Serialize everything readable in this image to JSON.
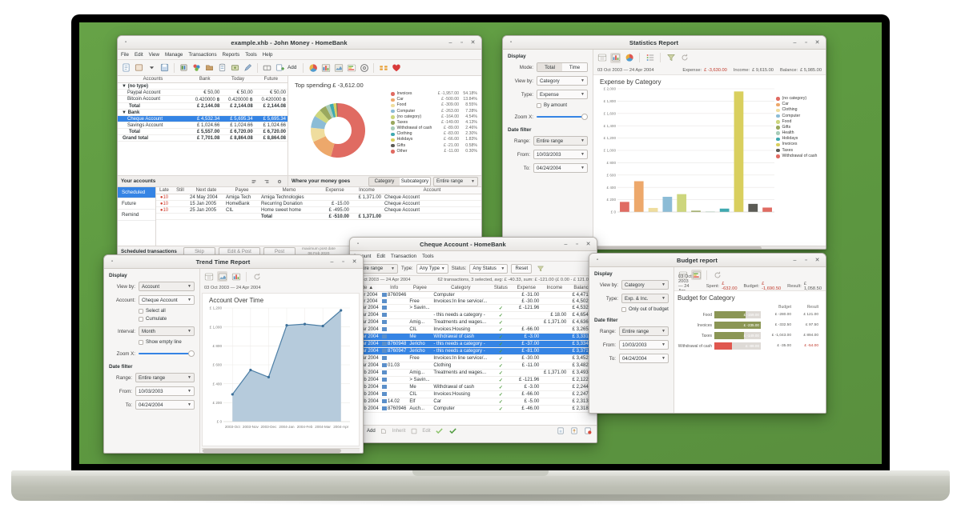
{
  "main_window": {
    "title": "example.xhb - John Money - HomeBank",
    "menus": [
      "File",
      "Edit",
      "View",
      "Manage",
      "Transactions",
      "Reports",
      "Tools",
      "Help"
    ],
    "toolbar": [
      "new-icon",
      "open-icon",
      "chevron-down-icon",
      "save-icon",
      "accounts-icon",
      "payees-icon",
      "categories-icon",
      "archive-icon",
      "budget-icon",
      "assign-icon",
      "ledger-icon",
      "add-icon"
    ],
    "add_label": "Add",
    "report_icons": [
      "pie-chart-icon",
      "statistics-icon",
      "trend-icon",
      "budget-report-icon",
      "vehicle-cost-icon",
      "balance-icon",
      "heart-icon"
    ],
    "accounts_panel": {
      "title": "Your accounts",
      "columns": [
        "Accounts",
        "Bank",
        "Today",
        "Future"
      ],
      "rows": [
        {
          "type": "group",
          "name": "(no type)",
          "bank": "",
          "today": "",
          "future": ""
        },
        {
          "type": "item",
          "name": "Paypal Account",
          "bank": "€ 50,00",
          "today": "€ 50,00",
          "future": "€ 50,00"
        },
        {
          "type": "item",
          "name": "Bitcoin Account",
          "bank": "0.420000 ฿",
          "today": "0.420000 ฿",
          "future": "0.420000 ฿"
        },
        {
          "type": "total",
          "name": "Total",
          "bank": "£ 2,144.08",
          "today": "£ 2,144.08",
          "future": "£ 2,144.08"
        },
        {
          "type": "group",
          "name": "Bank",
          "bank": "",
          "today": "",
          "future": ""
        },
        {
          "type": "selected",
          "name": "Cheque Account",
          "bank": "£ 4,532.34",
          "today": "£ 5,695.34",
          "future": "£ 5,695.34"
        },
        {
          "type": "item",
          "name": "Savings Account",
          "bank": "£ 1,024.66",
          "today": "£ 1,024.66",
          "future": "£ 1,024.66"
        },
        {
          "type": "total",
          "name": "Total",
          "bank": "£ 5,557.00",
          "today": "£ 6,720.00",
          "future": "£ 6,720.00"
        },
        {
          "type": "grand",
          "name": "Grand total",
          "bank": "£ 7,701.08",
          "today": "£ 8,864.08",
          "future": "£ 8,864.08"
        }
      ]
    },
    "spending_panel": {
      "title": "Where your money goes",
      "chart_heading": "Top spending £ -3,612.00",
      "buttons": [
        "Category",
        "Subcategory"
      ],
      "active_button": "Category",
      "range_value": "Entire range"
    },
    "scheduled": {
      "tabs": [
        "Scheduled",
        "Future",
        "Remind"
      ],
      "active_tab": "Scheduled",
      "columns": [
        "Late",
        "Still",
        "Next date",
        "Payee",
        "Memo",
        "Expense",
        "Income",
        "Account"
      ],
      "rows": [
        {
          "late": "10",
          "still": "",
          "next_date": "24 May 2004",
          "payee": "Amiga Tech",
          "memo": "Amiga Technologies",
          "expense": "",
          "income": "£ 1,371.00",
          "account": "Cheque Account"
        },
        {
          "late": "10",
          "still": "",
          "next_date": "15 Jan 2005",
          "payee": "HomeBank",
          "memo": "Recurring Donation",
          "expense": "£ -15.00",
          "income": "",
          "account": "Cheque Account"
        },
        {
          "late": "10",
          "still": "",
          "next_date": "25 Jan 2005",
          "payee": "CIL",
          "memo": "Home sweet home",
          "expense": "£ -495.00",
          "income": "",
          "account": "Cheque Account"
        }
      ],
      "total_label": "Total",
      "total_expense": "£ -510.00",
      "total_income": "£ 1,371.00",
      "footer_label": "Scheduled transactions",
      "footer_buttons": [
        "Skip",
        "Edit & Post",
        "Post"
      ],
      "maxpost_label": "maximum post date",
      "maxpost_value": "06 Feb 2020"
    }
  },
  "statistics_window": {
    "title": "Statistics Report",
    "display_label": "Display",
    "mode_label": "Mode:",
    "mode_options": [
      "Total",
      "Time"
    ],
    "mode_active": "Total",
    "viewby_label": "View by:",
    "viewby_value": "Category",
    "type_label": "Type:",
    "type_value": "Expense",
    "byamount_label": "By amount",
    "zoom_label": "Zoom X:",
    "datefilter_label": "Date filter",
    "range_label": "Range:",
    "range_value": "Entire range",
    "from_label": "From:",
    "from_value": "10/03/2003",
    "to_label": "To:",
    "to_value": "04/24/2004",
    "toolbar_icons": [
      "list-view-icon",
      "column-chart-icon",
      "pie-chart-icon",
      "detail-icon",
      "filter-icon",
      "refresh-icon"
    ],
    "daterange_text": "03 Oct 2003 — 24 Apr 2004",
    "summary": {
      "expense_label": "Expense:",
      "expense_value": "£ -3,630.00",
      "income_label": "Income:",
      "income_value": "£ 9,615.00",
      "balance_label": "Balance:",
      "balance_value": "£ 5,985.00"
    }
  },
  "trend_window": {
    "title": "Trend Time Report",
    "display_label": "Display",
    "viewby_label": "View by:",
    "viewby_value": "Account",
    "account_label": "Account:",
    "account_value": "Cheque Account",
    "selectall_label": "Select all",
    "cumulate_label": "Cumulate",
    "interval_label": "Interval:",
    "interval_value": "Month",
    "showempty_label": "Show empty line",
    "zoom_label": "Zoom X:",
    "datefilter_label": "Date filter",
    "range_label": "Range:",
    "range_value": "Entire range",
    "from_label": "From:",
    "from_value": "10/03/2003",
    "to_label": "To:",
    "to_value": "04/24/2004",
    "toolbar_icons": [
      "list-view-icon",
      "area-chart-icon",
      "column-chart-icon",
      "refresh-icon"
    ],
    "daterange_text": "03 Oct 2003 — 24 Apr 2004"
  },
  "budget_window": {
    "title": "Budget report",
    "display_label": "Display",
    "viewby_label": "View by:",
    "viewby_value": "Category",
    "type_label": "Type:",
    "type_value": "Exp. & Inc.",
    "onlyout_label": "Only out of budget",
    "datefilter_label": "Date filter",
    "range_label": "Range:",
    "range_value": "Entire range",
    "from_label": "From:",
    "from_value": "10/03/2003",
    "to_label": "To:",
    "to_value": "04/24/2004",
    "toolbar_icons": [
      "list-view-icon",
      "stack-chart-icon",
      "refresh-icon"
    ],
    "daterange_text": "03 Oct 2003 — 24 Apr 2004",
    "summary": {
      "spent_label": "Spent:",
      "spent_value": "£ -632.00",
      "budget_label": "Budget:",
      "budget_value": "£ -1,690.50",
      "result_label": "Result:",
      "result_value": "£ 1,058.50"
    },
    "chart_heading": "Budget for Category",
    "col_budget": "Budget",
    "col_result": "Result"
  },
  "ledger_window": {
    "title": "Cheque Account - HomeBank",
    "menus": [
      "Account",
      "Edit",
      "Transaction",
      "Tools"
    ],
    "range_value": "Entire range",
    "type_label": "Type:",
    "type_value": "Any Type",
    "status_label": "Status:",
    "status_value": "Any Status",
    "reset_label": "Reset",
    "daterange_text": "03 Oct 2003 — 24 Apr 2004",
    "summary_text": "62 transactions, 3 selected, avg: £ -40.33, sum: £ -121.00 (£ 0.00 - £ 121.00)",
    "columns": [
      "Date",
      "Info",
      "Payee",
      "Category",
      "Status",
      "Expense",
      "Income",
      "Balance"
    ],
    "rows": [
      {
        "date": "04 Apr 2004",
        "info": "8760946",
        "payee": "",
        "category": "Computer",
        "status": "",
        "expense": "£ -31.00",
        "income": "",
        "balance": "£ 4,471.34",
        "selected": false
      },
      {
        "date": "03 Apr 2004",
        "info": "",
        "payee": "Free",
        "category": "Invoices:In line service/...",
        "status": "",
        "expense": "£ -30.00",
        "income": "",
        "balance": "£ 4,502.34",
        "selected": false
      },
      {
        "date": "30 Mar 2004",
        "info": "",
        "payee": "> Savin...",
        "category": "",
        "status": "ok",
        "expense": "£ -121.96",
        "income": "",
        "balance": "£ 4,532.34",
        "selected": false
      },
      {
        "date": "28 Mar 2004",
        "info": "",
        "payee": "",
        "category": "- this needs a category -",
        "status": "ok",
        "expense": "",
        "income": "£ 18.00",
        "balance": "£ 4,654.30",
        "selected": false
      },
      {
        "date": "27 Mar 2004",
        "info": "",
        "payee": "Amig...",
        "category": "Treatments and wages...",
        "status": "ok",
        "expense": "",
        "income": "£ 1,371.00",
        "balance": "£ 4,636.30",
        "selected": false
      },
      {
        "date": "15 Mar 2004",
        "info": "",
        "payee": "CIL",
        "category": "Invoices:Housing",
        "status": "ok",
        "expense": "£ -66.00",
        "income": "",
        "balance": "£ 3,265.30",
        "selected": false
      },
      {
        "date": "14 Mar 2004",
        "info": "",
        "payee": "Me",
        "category": "Withdrawal of cash",
        "status": "ok",
        "expense": "£ -3.00",
        "income": "",
        "balance": "£ 3,331.30",
        "selected": true
      },
      {
        "date": "14 Mar 2004",
        "info": "8760948",
        "payee": "Jericho",
        "category": "- this needs a category -",
        "status": "ok",
        "expense": "£ -37.00",
        "income": "",
        "balance": "£ 3,334.30",
        "selected": true
      },
      {
        "date": "12 Mar 2004",
        "info": "8760947",
        "payee": "Jericho",
        "category": "- this needs a category -",
        "status": "ok",
        "expense": "£ -81.00",
        "income": "",
        "balance": "£ 3,371.30",
        "selected": true
      },
      {
        "date": "03 Mar 2004",
        "info": "",
        "payee": "Free",
        "category": "Invoices:In line service/...",
        "status": "ok",
        "expense": "£ -30.00",
        "income": "",
        "balance": "£ 3,452.30",
        "selected": false
      },
      {
        "date": "01 Mar 2004",
        "info": "01.03",
        "payee": "",
        "category": "Clothing",
        "status": "ok",
        "expense": "£ -11.00",
        "income": "",
        "balance": "£ 3,482.30",
        "selected": false
      },
      {
        "date": "27 Feb 2004",
        "info": "",
        "payee": "Amig...",
        "category": "Treatments and wages...",
        "status": "ok",
        "expense": "",
        "income": "£ 1,371.00",
        "balance": "£ 3,493.30",
        "selected": false
      },
      {
        "date": "27 Feb 2004",
        "info": "",
        "payee": "> Savin...",
        "category": "",
        "status": "ok",
        "expense": "£ -121.96",
        "income": "",
        "balance": "£ 2,122.30",
        "selected": false
      },
      {
        "date": "25 Feb 2004",
        "info": "",
        "payee": "Me",
        "category": "Withdrawal of cash",
        "status": "ok",
        "expense": "£ -3.00",
        "income": "",
        "balance": "£ 2,244.26",
        "selected": false
      },
      {
        "date": "15 Feb 2004",
        "info": "",
        "payee": "CIL",
        "category": "Invoices:Housing",
        "status": "ok",
        "expense": "£ -66.00",
        "income": "",
        "balance": "£ 2,247.26",
        "selected": false
      },
      {
        "date": "14 Feb 2004",
        "info": "14.02",
        "payee": "Elf",
        "category": "Car",
        "status": "ok",
        "expense": "£ -5.00",
        "income": "",
        "balance": "£ 2,313.26",
        "selected": false
      },
      {
        "date": "05 Feb 2004",
        "info": "8760946",
        "payee": "Auch...",
        "category": "Computer",
        "status": "ok",
        "expense": "£ -46.00",
        "income": "",
        "balance": "£ 2,318.26",
        "selected": false
      }
    ],
    "footer_buttons": [
      "Add",
      "Inherit",
      "Edit"
    ]
  },
  "chart_data": [
    {
      "id": "top-spending-pie",
      "type": "pie",
      "title": "Top spending £ -3,612.00",
      "legend_position": "right",
      "categories": [
        "Invoices",
        "Car",
        "Food",
        "Computer",
        "(no category)",
        "Taxes",
        "Withdrawal of cash",
        "Clothing",
        "Holidays",
        "Gifts",
        "Other"
      ],
      "values": [
        1957.0,
        500.0,
        309.0,
        263.0,
        164.0,
        149.0,
        89.0,
        83.0,
        66.0,
        21.0,
        11.0
      ],
      "amount_labels": [
        "£ -1,957.00",
        "£ -500.00",
        "£ -309.00",
        "£ -263.00",
        "£ -164.00",
        "£ -149.00",
        "£ -89.00",
        "£ -83.00",
        "£ -66.00",
        "£ -21.00",
        "£ -11.00"
      ],
      "percent_labels": [
        "54.18%",
        "13.84%",
        "8.55%",
        "7.28%",
        "4.54%",
        "4.13%",
        "2.46%",
        "2.30%",
        "1.83%",
        "0.58%",
        "0.30%"
      ],
      "colors": [
        "#e06b62",
        "#eda86b",
        "#efdd9e",
        "#8cbcd6",
        "#cdd67d",
        "#9aa85e",
        "#a8ccb9",
        "#3fa9b0",
        "#d9cf5e",
        "#5b5b55",
        "#e06b62"
      ]
    },
    {
      "id": "expense-by-category-bars",
      "type": "bar",
      "title": "Expense by Category",
      "xlabel": "",
      "ylabel": "",
      "ylim": [
        0,
        2000
      ],
      "yticks": [
        "£ 0",
        "£ 200",
        "£ 400",
        "£ 600",
        "£ 800",
        "£ 1,000",
        "£ 1,200",
        "£ 1,400",
        "£ 1,600",
        "£ 1,800",
        "£ 2,000"
      ],
      "categories": [
        "(no category)",
        "Car",
        "Clothing",
        "Computer",
        "Food",
        "Gifts",
        "Health",
        "Holidays",
        "Invoices",
        "Taxes",
        "Withdrawal of cash"
      ],
      "values": [
        164,
        500,
        66,
        247,
        290,
        21,
        8,
        55,
        1957,
        132,
        72
      ],
      "colors": [
        "#e06b62",
        "#eda86b",
        "#efdd9e",
        "#8cbcd6",
        "#cdd67d",
        "#9aa85e",
        "#a8ccb9",
        "#3fa9b0",
        "#d9cf5e",
        "#5b5b55",
        "#e06b62"
      ],
      "legend_position": "right",
      "grid": true
    },
    {
      "id": "account-over-time-area",
      "type": "area",
      "title": "Account Over Time",
      "xlabel": "",
      "ylabel": "",
      "ylim": [
        0,
        1200
      ],
      "yticks": [
        "£ 0",
        "£ 200",
        "£ 400",
        "£ 600",
        "£ 800",
        "£ 1,000",
        "£ 1,200"
      ],
      "x": [
        "2003-Oct",
        "2003-Nov",
        "2003-Dec",
        "2004-Jan",
        "2004-Feb",
        "2004-Mar",
        "2004-Apr"
      ],
      "values": [
        288,
        545,
        470,
        1017,
        1030,
        1010,
        1175
      ],
      "color": "#7ca6c4",
      "grid": true
    },
    {
      "id": "budget-for-category",
      "type": "bar",
      "title": "Budget for Category",
      "orientation": "horizontal",
      "categories": [
        "Food",
        "Invoices",
        "Taxes",
        "Withdrawal of cash"
      ],
      "spent_labels": [
        "£ -159.00",
        "£ -235.00",
        "£ -149.00",
        "£ -89.00"
      ],
      "values": [
        159.0,
        235.0,
        149.0,
        89.0
      ],
      "budget": [
        "£ -280.00",
        "£ -332.50",
        "£ -1,043.00",
        "£ -35.00"
      ],
      "result": [
        "£ 121.00",
        "£ 97.50",
        "£ 894.00",
        "£ -54.00"
      ],
      "bar_colors": [
        "#8b9655",
        "#8b9655",
        "#8b9655",
        "#e0574f"
      ]
    }
  ]
}
